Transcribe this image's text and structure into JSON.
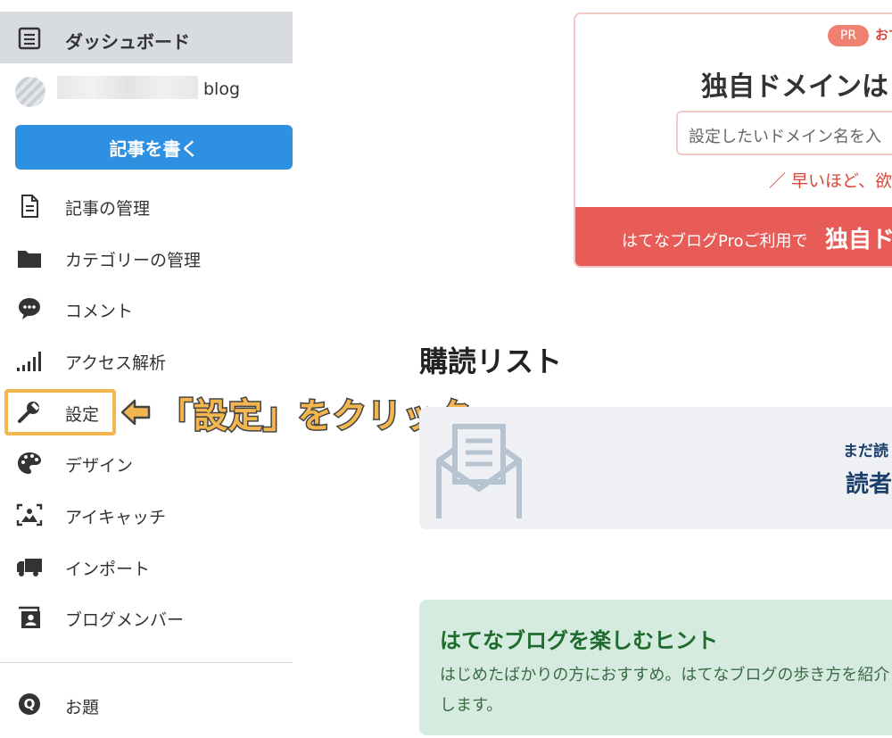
{
  "sidebar": {
    "dashboard_label": "ダッシュボード",
    "blog_suffix": "blog",
    "write_button": "記事を書く",
    "items": [
      {
        "label": "記事の管理",
        "icon": "document-icon"
      },
      {
        "label": "カテゴリーの管理",
        "icon": "folder-icon"
      },
      {
        "label": "コメント",
        "icon": "comment-icon"
      },
      {
        "label": "アクセス解析",
        "icon": "bar-chart-icon"
      },
      {
        "label": "設定",
        "icon": "wrench-icon"
      },
      {
        "label": "デザイン",
        "icon": "palette-icon"
      },
      {
        "label": "アイキャッチ",
        "icon": "image-icon"
      },
      {
        "label": "インポート",
        "icon": "truck-icon"
      },
      {
        "label": "ブログメンバー",
        "icon": "member-icon"
      }
    ],
    "odai_label": "お題"
  },
  "annotation": {
    "text": "「設定」をクリック",
    "color": "#f3b64e"
  },
  "promo": {
    "badge": "PR",
    "tag": "おす",
    "title": "独自ドメインは",
    "input_placeholder": "設定したいドメイン名を入",
    "note": "／ 早いほど、欲",
    "bar_text": "はてなブログProご利用で",
    "bar_emphasis": "独自ド"
  },
  "reading_list": {
    "title": "購読リスト",
    "message_line1": "まだ読",
    "message_line2": "読者"
  },
  "hint": {
    "title": "はてなブログを楽しむヒント",
    "body": "はじめたばかりの方におすすめ。はてなブログの歩き方を紹介します。"
  },
  "colors": {
    "accent_blue": "#2e90e0",
    "promo_red": "#e85c57",
    "hint_green": "#1e6b2e",
    "highlight": "#f3b64e"
  }
}
